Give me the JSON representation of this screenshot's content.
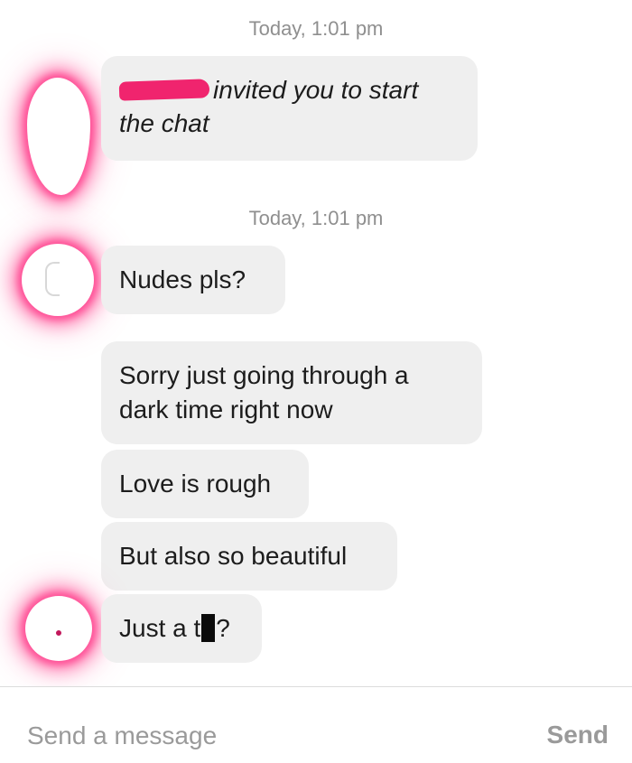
{
  "chat": {
    "timestamps": [
      "Today, 1:01 pm",
      "Today, 1:01 pm"
    ],
    "invite_line1": "invited you to start",
    "invite_line2": "the chat",
    "messages": {
      "nudes": "Nudes pls?",
      "sorry_line1": "Sorry just going through a",
      "sorry_line2": "dark time right now",
      "love": "Love is rough",
      "beautiful": "But also so beautiful",
      "just_pre": "Just a t",
      "just_post": "?"
    }
  },
  "composer": {
    "placeholder": "Send a message",
    "send_label": "Send"
  },
  "colors": {
    "bubble": "#efefef",
    "timestamp": "#8f8f8f",
    "redaction_pink": "#f0246e",
    "avatar_glow": "#ff4f96"
  }
}
